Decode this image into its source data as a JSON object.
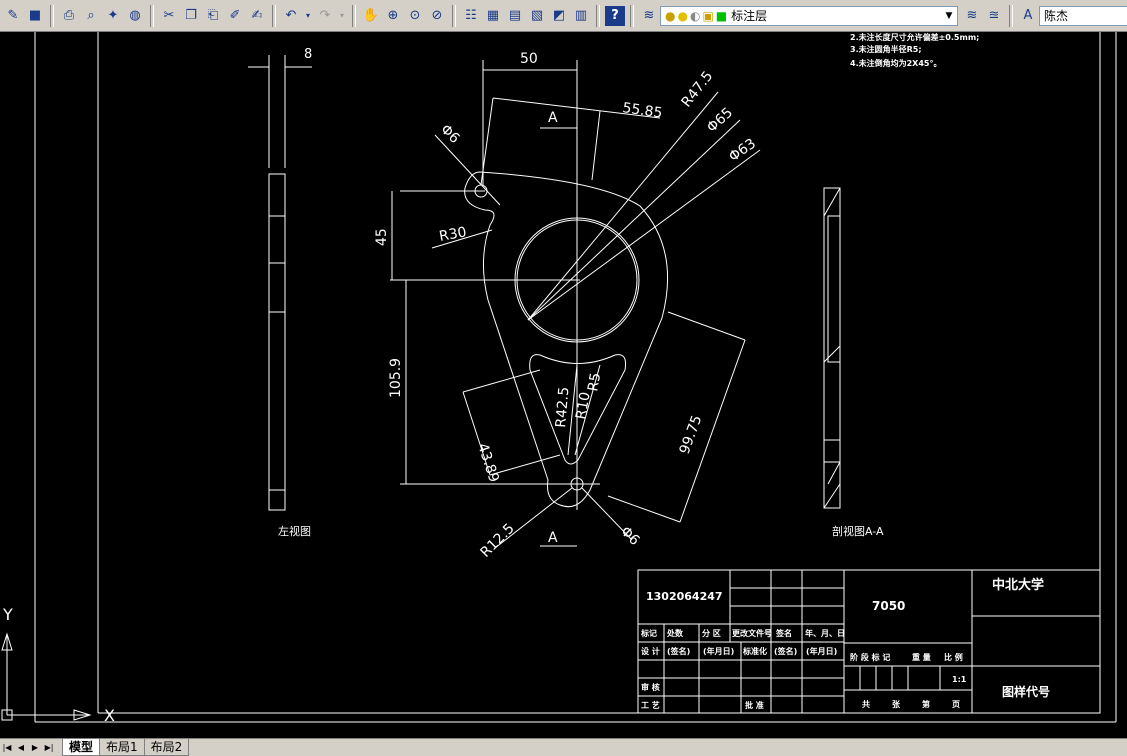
{
  "toolbar": {
    "layer_combo": "标注层",
    "user_combo": "陈杰"
  },
  "drawing": {
    "dims": {
      "d8": "8",
      "d50": "50",
      "d5585": "55.85",
      "r475": "R47.5",
      "phi65": "Φ65",
      "phi63": "Φ63",
      "phi6a": "Φ6",
      "r30": "R30",
      "d45": "45",
      "d1059": "105.9",
      "d4389": "43.89",
      "r425": "R42.5",
      "r10": "R10",
      "r5": "R5",
      "d9975": "99.75",
      "r125": "R12.5",
      "phi6b": "Φ6",
      "secA_top": "A",
      "secA_bottom": "A"
    },
    "left_view_label": "左视图",
    "section_view_label": "剖视图A-A",
    "notes": [
      "2.未注长度尺寸允许偏差±0.5mm;",
      "3.未注圆角半径R5;",
      "4.未注倒角均为2X45°。"
    ]
  },
  "title_block": {
    "student_id": "1302064247",
    "part_no": "7050",
    "school": "中北大学",
    "drawing_code": "图样代号",
    "row_labels": {
      "biaoji": "标记",
      "chushu": "处数",
      "fenqu": "分 区",
      "genggai": "更改文件号",
      "qianming": "签名",
      "nyr": "年、月、日",
      "sheji": "设 计",
      "qianming2": "(签名)",
      "nianyueri": "(年月日)",
      "biaozhunhua": "标准化",
      "qianming3": "(签名)",
      "nianyueri2": "(年月日)",
      "shenhe": "审 核",
      "gongyi": "工 艺",
      "pizhun": "批 准"
    },
    "stage_labels": {
      "jieduan": "阶 段 标 记",
      "zhongliang": "重 量",
      "bili": "比 例",
      "scale": "1:1",
      "gong": "共",
      "zhang": "张",
      "di": "第",
      "ye": "页"
    }
  },
  "ucs": {
    "y": "Y",
    "x": "X"
  },
  "tabs": {
    "model": "模型",
    "layout1": "布局1",
    "layout2": "布局2"
  }
}
